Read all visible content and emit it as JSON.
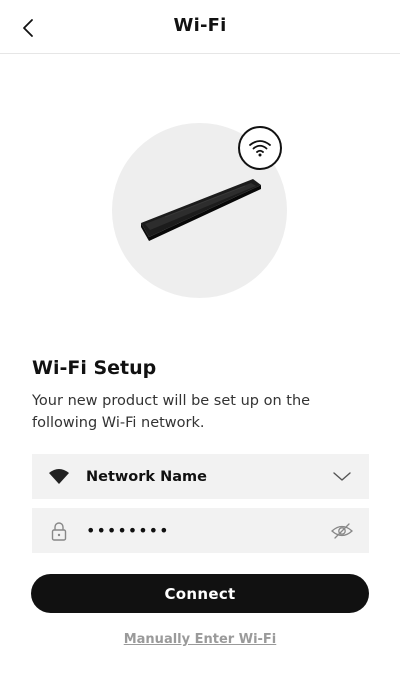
{
  "header": {
    "title": "Wi-Fi",
    "back_icon": "chevron-left-icon"
  },
  "hero": {
    "image": "soundbar-product",
    "badge_icon": "wifi-icon"
  },
  "setup": {
    "title": "Wi-Fi Setup",
    "description": "Your new product will be set up on the following Wi-Fi network."
  },
  "network": {
    "icon": "wifi-signal-icon",
    "name": "Network Name",
    "dropdown_icon": "chevron-down-icon"
  },
  "password": {
    "icon": "lock-icon",
    "value": "••••••••",
    "visibility_icon": "eye-off-icon"
  },
  "actions": {
    "connect_label": "Connect",
    "manual_label": "Manually Enter Wi-Fi"
  },
  "colors": {
    "primary": "#111111",
    "field_bg": "#f2f2f2",
    "link": "#9a9a9a"
  }
}
